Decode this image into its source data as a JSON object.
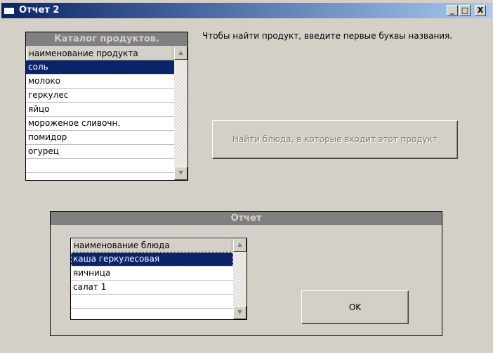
{
  "window": {
    "title": "Отчет 2",
    "minimize": "_",
    "maximize": "□",
    "close": "X"
  },
  "catalog": {
    "title": "Каталог продуктов.",
    "column": "наименование продукта",
    "items": [
      "соль",
      "молоко",
      "геркулес",
      "яйцо",
      "мороженое сливочн.",
      "помидор",
      "огурец",
      ""
    ],
    "selected": 0
  },
  "hint": "Чтобы найти продукт, введите первые буквы названия.",
  "find_button": "Найти блюда, в которые входит этот продукт",
  "report": {
    "title": "Отчет",
    "column": "наименование блюда",
    "items": [
      "каша геркулесовая",
      "яичница",
      "салат 1",
      ""
    ],
    "selected": 0
  },
  "ok_button": "OK",
  "colors": {
    "selection": "#0a246a",
    "face": "#d4d0c8",
    "header": "#808080"
  }
}
